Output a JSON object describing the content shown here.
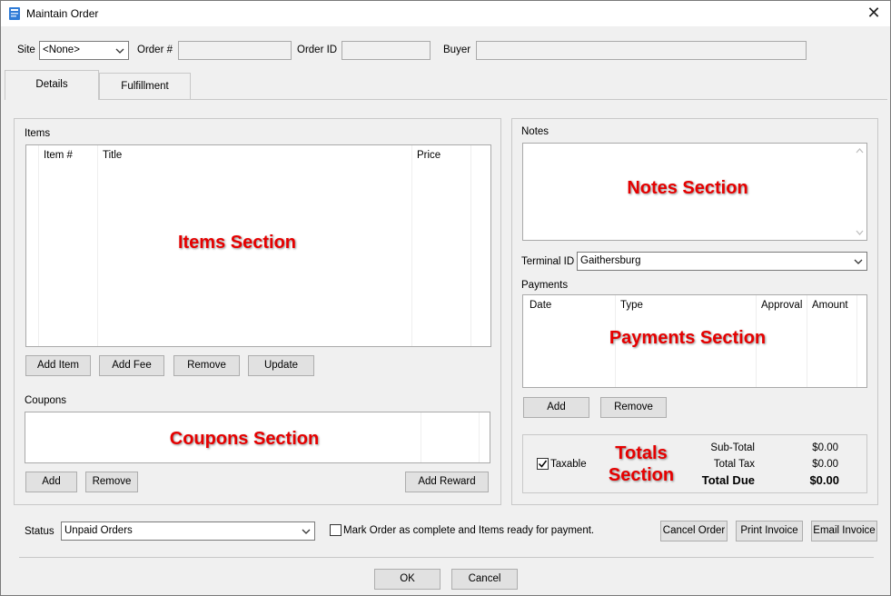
{
  "window": {
    "title": "Maintain Order",
    "close_glyph": "✕"
  },
  "header": {
    "site_label": "Site",
    "site_value": "<None>",
    "order_num_label": "Order #",
    "order_id_label": "Order ID",
    "buyer_label": "Buyer"
  },
  "tabs": [
    {
      "label": "Details"
    },
    {
      "label": "Fulfillment"
    }
  ],
  "items": {
    "label": "Items",
    "columns": [
      "Item #",
      "Title",
      "Price"
    ],
    "overlay": "Items Section",
    "buttons": {
      "add_item": "Add Item",
      "add_fee": "Add Fee",
      "remove": "Remove",
      "update": "Update"
    }
  },
  "coupons": {
    "label": "Coupons",
    "overlay": "Coupons Section",
    "buttons": {
      "add": "Add",
      "remove": "Remove",
      "add_reward": "Add Reward"
    }
  },
  "notes": {
    "label": "Notes",
    "overlay": "Notes Section"
  },
  "terminal": {
    "label": "Terminal ID",
    "value": "Gaithersburg"
  },
  "payments": {
    "label": "Payments",
    "columns": [
      "Date",
      "Type",
      "Approval",
      "Amount"
    ],
    "overlay": "Payments Section",
    "buttons": {
      "add": "Add",
      "remove": "Remove"
    }
  },
  "totals": {
    "taxable_label": "Taxable",
    "taxable_checked": true,
    "overlay_line1": "Totals",
    "overlay_line2": "Section",
    "subtotal_label": "Sub-Total",
    "subtotal_value": "$0.00",
    "tax_label": "Total Tax",
    "tax_value": "$0.00",
    "due_label": "Total Due",
    "due_value": "$0.00"
  },
  "status": {
    "label": "Status",
    "value": "Unpaid Orders",
    "complete_label": "Mark Order as complete and Items ready for payment."
  },
  "actions": {
    "cancel_order": "Cancel Order",
    "print_invoice": "Print Invoice",
    "email_invoice": "Email Invoice"
  },
  "footer": {
    "ok": "OK",
    "cancel": "Cancel"
  },
  "colors": {
    "overlay_red": "#e60000",
    "window_bg": "#f0f0f0"
  }
}
